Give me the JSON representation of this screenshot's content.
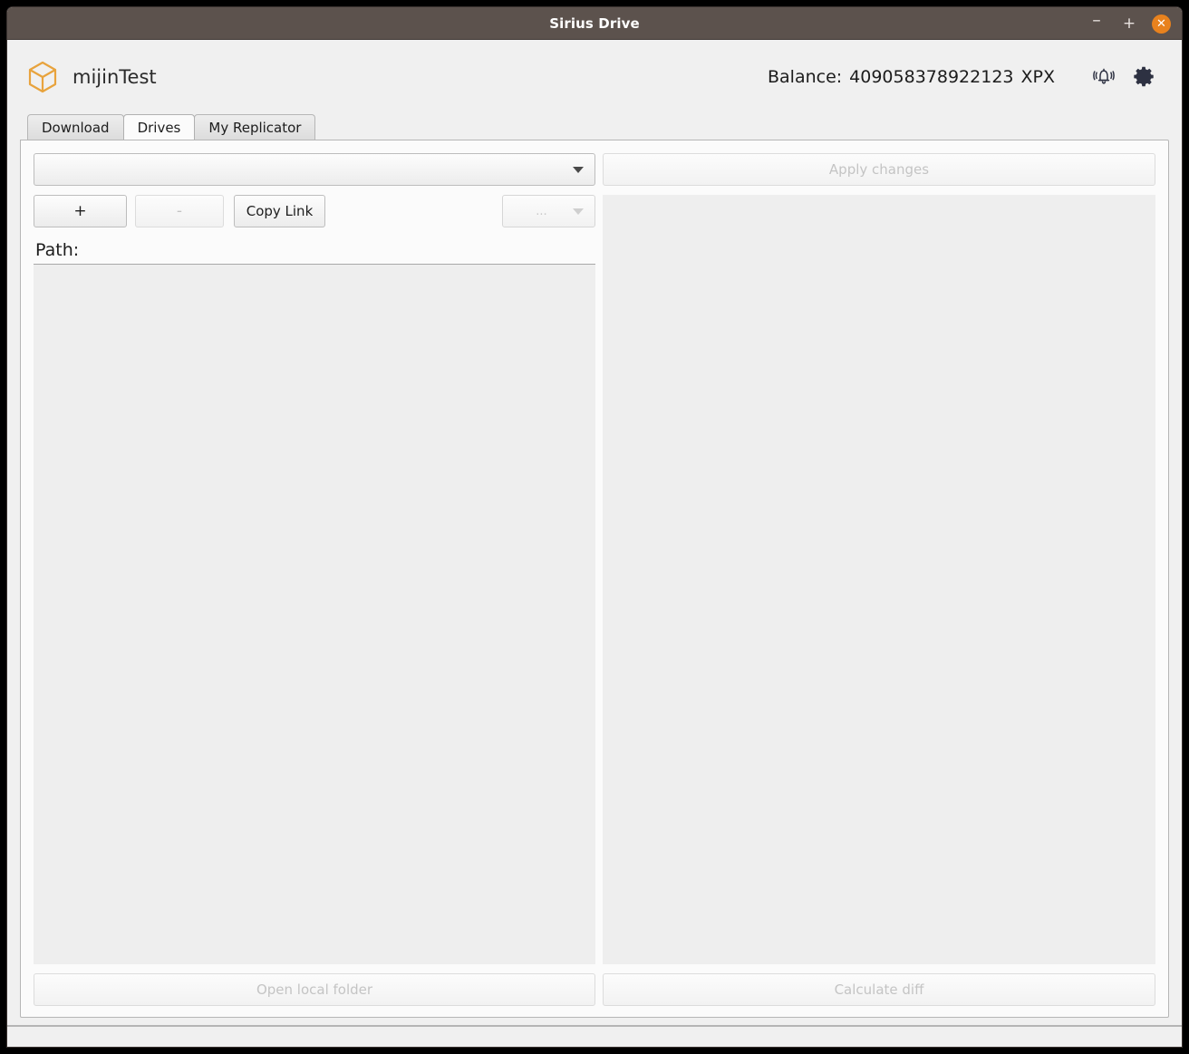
{
  "window": {
    "title": "Sirius Drive",
    "controls": {
      "minimize": "–",
      "maximize": "+",
      "close": "✕"
    }
  },
  "header": {
    "brand_name": "mijinTest",
    "logo_icon": "cube-icon",
    "logo_color": "#e8a33d",
    "balance_label": "Balance:",
    "balance_amount": "409058378922123",
    "balance_currency": "XPX",
    "notification_icon": "bell-icon",
    "settings_icon": "gear-icon",
    "icon_color": "#2d3142"
  },
  "tabs": [
    {
      "label": "Download",
      "active": false
    },
    {
      "label": "Drives",
      "active": true
    },
    {
      "label": "My Replicator",
      "active": false
    }
  ],
  "drives_tab": {
    "drive_select": {
      "value": "",
      "placeholder": "",
      "enabled": true
    },
    "apply_changes_button": {
      "label": "Apply changes",
      "enabled": false
    },
    "toolbar": {
      "add_button": {
        "label": "+",
        "enabled": true
      },
      "remove_button": {
        "label": "-",
        "enabled": false
      },
      "copy_link_button": {
        "label": "Copy Link",
        "enabled": true
      },
      "more_select": {
        "label": "...",
        "enabled": false
      }
    },
    "path_label": "Path:",
    "local_files_list": {
      "items": []
    },
    "remote_files_list": {
      "items": []
    },
    "open_local_folder_button": {
      "label": "Open local folder",
      "enabled": false
    },
    "calculate_diff_button": {
      "label": "Calculate diff",
      "enabled": false
    }
  },
  "colors": {
    "titlebar_bg": "#5c524d",
    "close_button_bg": "#e8821e",
    "window_bg": "#f0f0f0",
    "pane_bg": "#fbfbfb",
    "list_bg": "#eeeeee",
    "disabled_text": "#c4c4c4"
  }
}
